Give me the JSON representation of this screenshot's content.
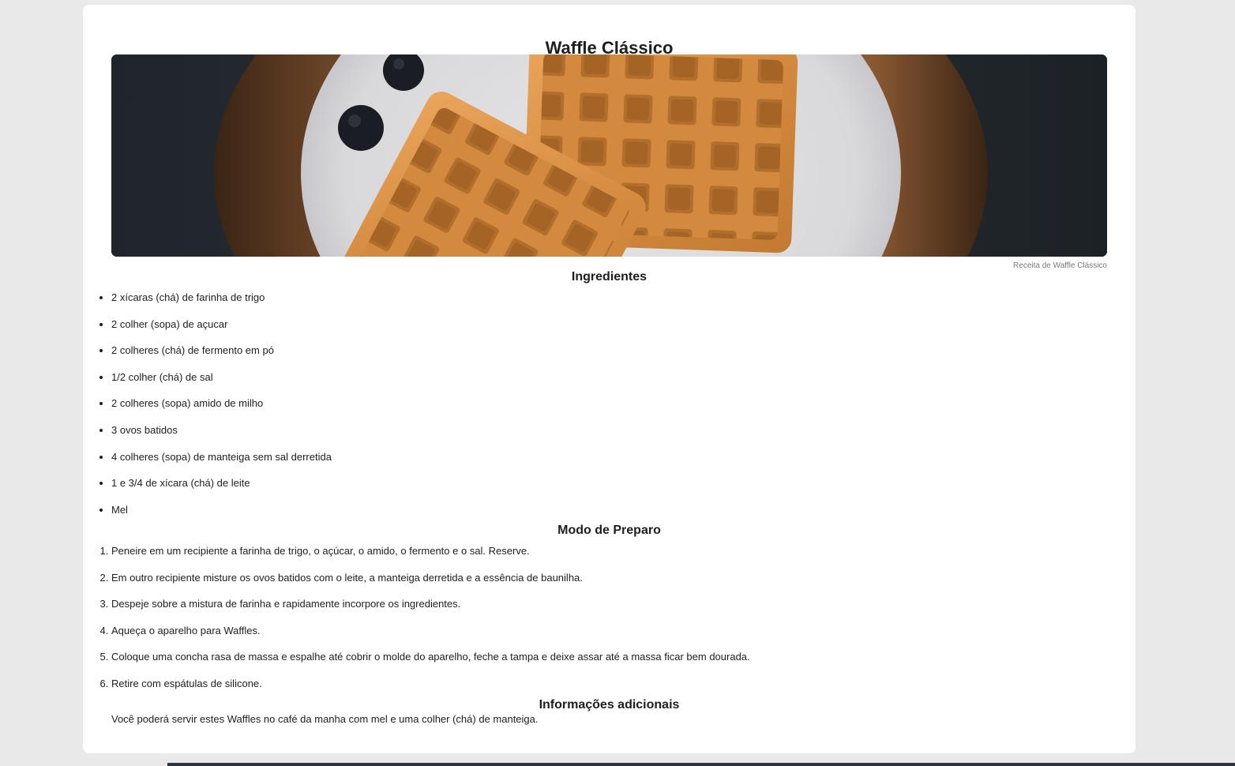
{
  "recipe": {
    "title": "Waffle Clássico",
    "image_caption": "Receita de Waffle Clássico",
    "ingredients_title": "Ingredientes",
    "ingredients": [
      "2 xícaras (chá) de farinha de trigo",
      "2 colher (sopa) de açucar",
      "2 colheres (chá) de fermento em pó",
      "1/2 colher (chá) de sal",
      "2 colheres (sopa) amido de milho",
      "3 ovos batidos",
      "4 colheres (sopa) de manteiga sem sal derretida",
      "1 e 3/4 de xícara (chá) de leite",
      "Mel"
    ],
    "steps_title": "Modo de Preparo",
    "steps": [
      "Peneire em um recipiente a farinha de trigo, o açúcar, o amido, o fermento e o sal. Reserve.",
      "Em outro recipiente misture os ovos batidos com o leite, a manteiga derretida e a essência de baunilha.",
      "Despeje sobre a mistura de farinha e rapidamente incorpore os ingredientes.",
      "Aqueça o aparelho para Waffles.",
      "Coloque uma concha rasa de massa e espalhe até cobrir o molde do aparelho, feche a tampa e deixe assar até a massa ficar bem dourada.",
      "Retire com espátulas de silicone."
    ],
    "info_title": "Informações adicionais",
    "info_text": "Você poderá servir estes Waffles no café da manha com mel e uma colher (chá) de manteiga."
  },
  "colors": {
    "page_background": "#e9e9e9",
    "card_background": "#ffffff",
    "text": "#1e1e1e",
    "caption": "#7a7a7a"
  }
}
